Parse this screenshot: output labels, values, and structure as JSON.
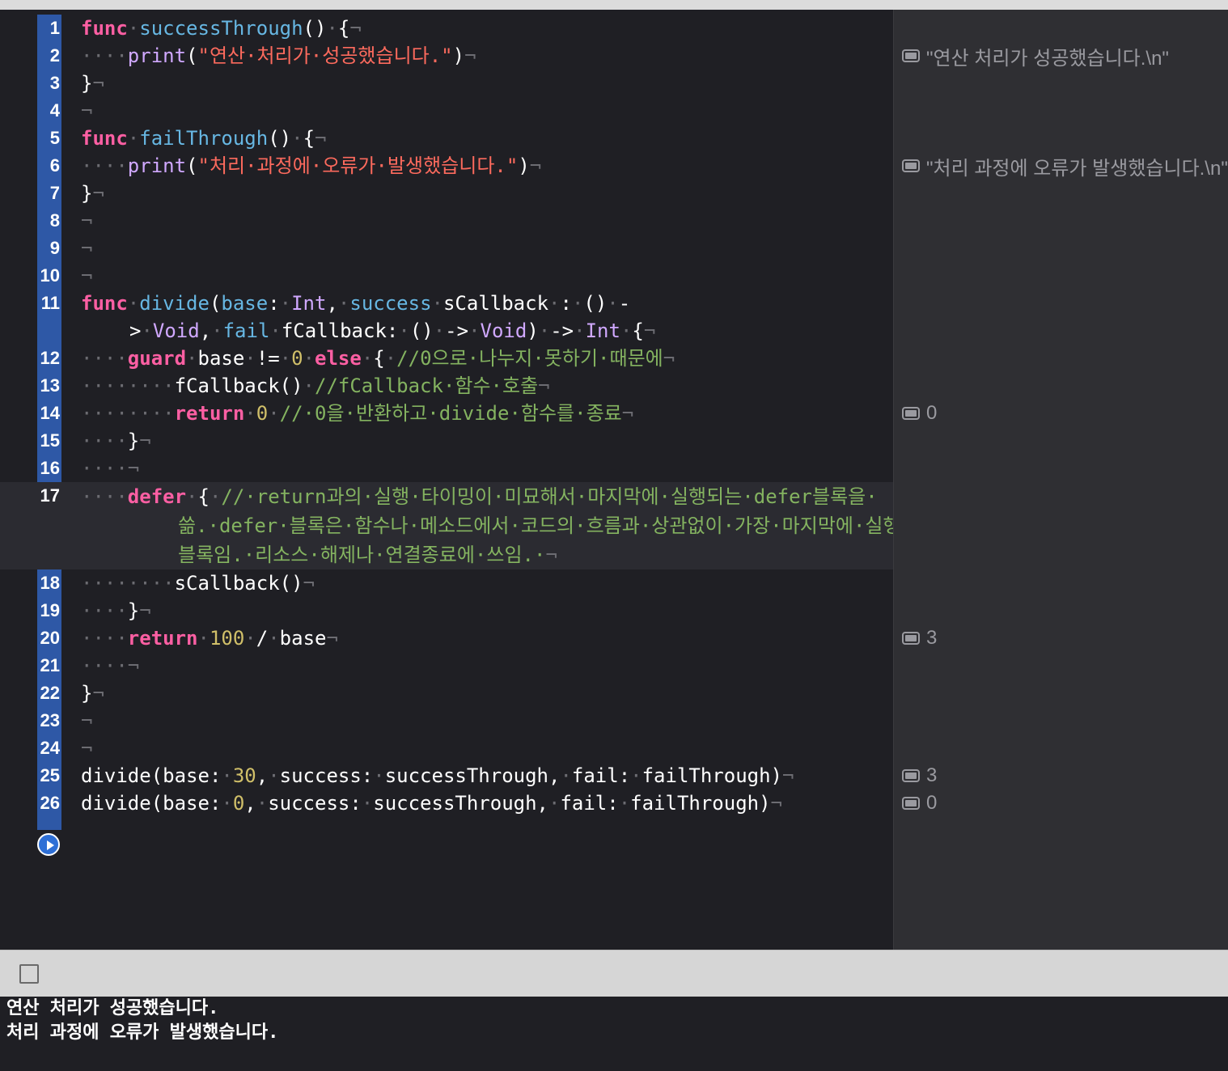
{
  "editor": {
    "lines": [
      {
        "n": "1",
        "tokens": [
          [
            "kw",
            "func"
          ],
          [
            "ws",
            "·"
          ],
          [
            "fn",
            "successThrough"
          ],
          [
            "",
            "()"
          ],
          [
            "ws",
            "·"
          ],
          [
            "",
            "{"
          ],
          [
            "ws",
            "¬"
          ]
        ]
      },
      {
        "n": "2",
        "tokens": [
          [
            "ws",
            "····"
          ],
          [
            "tp",
            "print"
          ],
          [
            "",
            "("
          ],
          [
            "str",
            "\"연산·처리가·성공했습니다.\""
          ],
          [
            "",
            ")"
          ],
          [
            "ws",
            "¬"
          ]
        ]
      },
      {
        "n": "3",
        "tokens": [
          [
            "",
            "}"
          ],
          [
            "ws",
            "¬"
          ]
        ]
      },
      {
        "n": "4",
        "tokens": [
          [
            "ws",
            "¬"
          ]
        ]
      },
      {
        "n": "5",
        "tokens": [
          [
            "kw",
            "func"
          ],
          [
            "ws",
            "·"
          ],
          [
            "fn",
            "failThrough"
          ],
          [
            "",
            "()"
          ],
          [
            "ws",
            "·"
          ],
          [
            "",
            "{"
          ],
          [
            "ws",
            "¬"
          ]
        ]
      },
      {
        "n": "6",
        "tokens": [
          [
            "ws",
            "····"
          ],
          [
            "tp",
            "print"
          ],
          [
            "",
            "("
          ],
          [
            "str",
            "\"처리·과정에·오류가·발생했습니다.\""
          ],
          [
            "",
            ")"
          ],
          [
            "ws",
            "¬"
          ]
        ]
      },
      {
        "n": "7",
        "tokens": [
          [
            "",
            "}"
          ],
          [
            "ws",
            "¬"
          ]
        ]
      },
      {
        "n": "8",
        "tokens": [
          [
            "ws",
            "¬"
          ]
        ]
      },
      {
        "n": "9",
        "tokens": [
          [
            "ws",
            "¬"
          ]
        ]
      },
      {
        "n": "10",
        "tokens": [
          [
            "ws",
            "¬"
          ]
        ]
      },
      {
        "n": "11",
        "wrap": "tall2",
        "tokens": [
          [
            "kw",
            "func"
          ],
          [
            "ws",
            "·"
          ],
          [
            "fn",
            "divide"
          ],
          [
            "",
            "("
          ],
          [
            "fn",
            "base"
          ],
          [
            "",
            ":"
          ],
          [
            "ws",
            "·"
          ],
          [
            "tp",
            "Int"
          ],
          [
            "",
            ","
          ],
          [
            "ws",
            "·"
          ],
          [
            "fn",
            "success"
          ],
          [
            "ws",
            "·"
          ],
          [
            "",
            "sCallback"
          ],
          [
            "ws",
            "·"
          ],
          [
            "",
            ":"
          ],
          [
            "ws",
            "·"
          ],
          [
            "",
            "()"
          ],
          [
            "ws",
            "·"
          ],
          [
            "",
            "->"
          ],
          [
            "ws",
            "·"
          ],
          [
            "tp",
            "Void"
          ],
          [
            "",
            ","
          ],
          [
            "ws",
            "·"
          ],
          [
            "fn",
            "fail"
          ],
          [
            "ws",
            "·"
          ],
          [
            "",
            "fCallback:"
          ],
          [
            "ws",
            "·"
          ],
          [
            "",
            "()"
          ],
          [
            "ws",
            "·"
          ],
          [
            "",
            "->"
          ],
          [
            "ws",
            "·"
          ],
          [
            "tp",
            "Void"
          ],
          [
            "",
            ")"
          ],
          [
            "ws",
            "·"
          ],
          [
            "",
            "->"
          ],
          [
            "ws",
            "·"
          ],
          [
            "tp",
            "Int"
          ],
          [
            "ws",
            "·"
          ],
          [
            "",
            "{"
          ],
          [
            "ws",
            "¬"
          ]
        ]
      },
      {
        "n": "12",
        "tokens": [
          [
            "ws",
            "····"
          ],
          [
            "kw",
            "guard"
          ],
          [
            "ws",
            "·"
          ],
          [
            "",
            "base"
          ],
          [
            "ws",
            "·"
          ],
          [
            "",
            "!="
          ],
          [
            "ws",
            "·"
          ],
          [
            "num-lit",
            "0"
          ],
          [
            "ws",
            "·"
          ],
          [
            "kw",
            "else"
          ],
          [
            "ws",
            "·"
          ],
          [
            "",
            "{"
          ],
          [
            "ws",
            "·"
          ],
          [
            "cmt",
            "//0으로·나누지·못하기·때문에"
          ],
          [
            "ws",
            "¬"
          ]
        ]
      },
      {
        "n": "13",
        "tokens": [
          [
            "ws",
            "········"
          ],
          [
            "",
            "fCallback()"
          ],
          [
            "ws",
            "·"
          ],
          [
            "cmt",
            "//fCallback·함수·호출"
          ],
          [
            "ws",
            "¬"
          ]
        ]
      },
      {
        "n": "14",
        "tokens": [
          [
            "ws",
            "········"
          ],
          [
            "kw",
            "return"
          ],
          [
            "ws",
            "·"
          ],
          [
            "num-lit",
            "0"
          ],
          [
            "ws",
            "·"
          ],
          [
            "cmt",
            "//·0을·반환하고·divide·함수를·종료"
          ],
          [
            "ws",
            "¬"
          ]
        ]
      },
      {
        "n": "15",
        "tokens": [
          [
            "ws",
            "····"
          ],
          [
            "",
            "}"
          ],
          [
            "ws",
            "¬"
          ]
        ]
      },
      {
        "n": "16",
        "tokens": [
          [
            "ws",
            "····¬"
          ]
        ]
      },
      {
        "n": "17",
        "wrap": "tall3",
        "current": true,
        "tokens": [
          [
            "ws",
            "····"
          ],
          [
            "kw",
            "defer"
          ],
          [
            "ws",
            "·"
          ],
          [
            "",
            "{"
          ],
          [
            "ws",
            "·"
          ],
          [
            "cmt",
            "//·return과의·실행·타이밍이·미묘해서·마지막에·실행되는·defer블록을·쓺.·defer·블록은·함수나·메소드에서·코드의·흐름과·상관없이·가장·마지막에·실행되는·블록임.·리소스·해제나·연결종료에·쓰임.·"
          ],
          [
            "ws",
            "¬"
          ]
        ]
      },
      {
        "n": "18",
        "tokens": [
          [
            "ws",
            "········"
          ],
          [
            "",
            "sCallback()"
          ],
          [
            "ws",
            "¬"
          ]
        ]
      },
      {
        "n": "19",
        "tokens": [
          [
            "ws",
            "····"
          ],
          [
            "",
            "}"
          ],
          [
            "ws",
            "¬"
          ]
        ]
      },
      {
        "n": "20",
        "tokens": [
          [
            "ws",
            "····"
          ],
          [
            "kw",
            "return"
          ],
          [
            "ws",
            "·"
          ],
          [
            "num-lit",
            "100"
          ],
          [
            "ws",
            "·"
          ],
          [
            "",
            "/"
          ],
          [
            "ws",
            "·"
          ],
          [
            "",
            "base"
          ],
          [
            "ws",
            "¬"
          ]
        ]
      },
      {
        "n": "21",
        "tokens": [
          [
            "ws",
            "····¬"
          ]
        ]
      },
      {
        "n": "22",
        "tokens": [
          [
            "",
            "}"
          ],
          [
            "ws",
            "¬"
          ]
        ]
      },
      {
        "n": "23",
        "tokens": [
          [
            "ws",
            "¬"
          ]
        ]
      },
      {
        "n": "24",
        "tokens": [
          [
            "ws",
            "¬"
          ]
        ]
      },
      {
        "n": "25",
        "tokens": [
          [
            "",
            "divide(base:"
          ],
          [
            "ws",
            "·"
          ],
          [
            "num-lit",
            "30"
          ],
          [
            "",
            ","
          ],
          [
            "ws",
            "·"
          ],
          [
            "",
            "success:"
          ],
          [
            "ws",
            "·"
          ],
          [
            "",
            "successThrough,"
          ],
          [
            "ws",
            "·"
          ],
          [
            "",
            "fail:"
          ],
          [
            "ws",
            "·"
          ],
          [
            "",
            "failThrough)"
          ],
          [
            "ws",
            "¬"
          ]
        ]
      },
      {
        "n": "26",
        "tokens": [
          [
            "",
            "divide(base:"
          ],
          [
            "ws",
            "·"
          ],
          [
            "num-lit",
            "0"
          ],
          [
            "",
            ","
          ],
          [
            "ws",
            "·"
          ],
          [
            "",
            "success:"
          ],
          [
            "ws",
            "·"
          ],
          [
            "",
            "successThrough,"
          ],
          [
            "ws",
            "·"
          ],
          [
            "",
            "fail:"
          ],
          [
            "ws",
            "·"
          ],
          [
            "",
            "failThrough)"
          ],
          [
            "ws",
            "¬"
          ]
        ]
      }
    ],
    "run_button_icon": "play-icon"
  },
  "results": [
    {
      "line": "2",
      "text": "\"연산 처리가 성공했습니다.\\n\""
    },
    {
      "line": "6",
      "text": "\"처리 과정에 오류가 발생했습니다.\\n\""
    },
    {
      "line": "14",
      "text": "0"
    },
    {
      "line": "20",
      "text": "3"
    },
    {
      "line": "25",
      "text": "3"
    },
    {
      "line": "26",
      "text": "0"
    }
  ],
  "console": {
    "toggle_icon": "checkbox-icon",
    "output": [
      "연산 처리가 성공했습니다.",
      "처리 과정에 오류가 발생했습니다."
    ]
  }
}
